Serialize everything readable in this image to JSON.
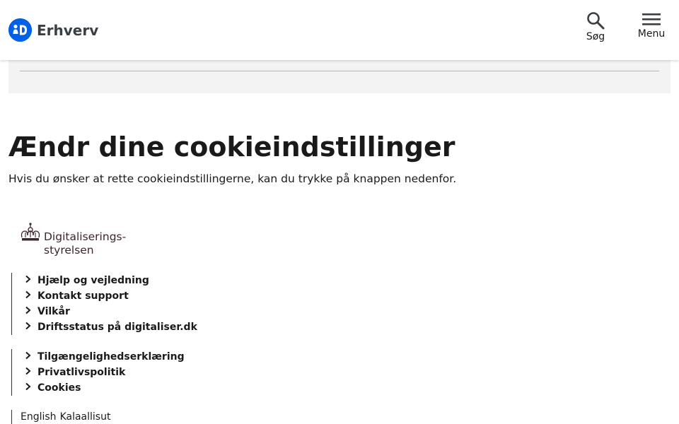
{
  "header": {
    "logo_badge": "≗D",
    "logo_text": "Erhverv",
    "search_label": "Søg",
    "menu_label": "Menu"
  },
  "main": {
    "title": "Ændr dine cookieindstillinger",
    "subtitle": "Hvis du ønsker at rette cookieindstillingerne, kan du trykke på knappen nedenfor."
  },
  "footer": {
    "org_name_line1": "Digitaliserings-",
    "org_name_line2": "styrelsen",
    "group1": [
      {
        "label": "Hjælp og vejledning"
      },
      {
        "label": "Kontakt support"
      },
      {
        "label": "Vilkår"
      },
      {
        "label": "Driftsstatus på digitaliser.dk"
      }
    ],
    "group2": [
      {
        "label": "Tilgængelighedserklæring"
      },
      {
        "label": "Privatlivspolitik"
      },
      {
        "label": "Cookies"
      }
    ],
    "languages": [
      "English",
      "Kalaallisut"
    ]
  },
  "colors": {
    "brand": "#0060e6",
    "text": "#1a1a1a",
    "panel": "#f3f3f3"
  },
  "icons": {
    "search": "search-icon",
    "menu": "hamburger-menu-icon",
    "chevron": "chevron-right-icon",
    "crown": "crown-icon"
  }
}
